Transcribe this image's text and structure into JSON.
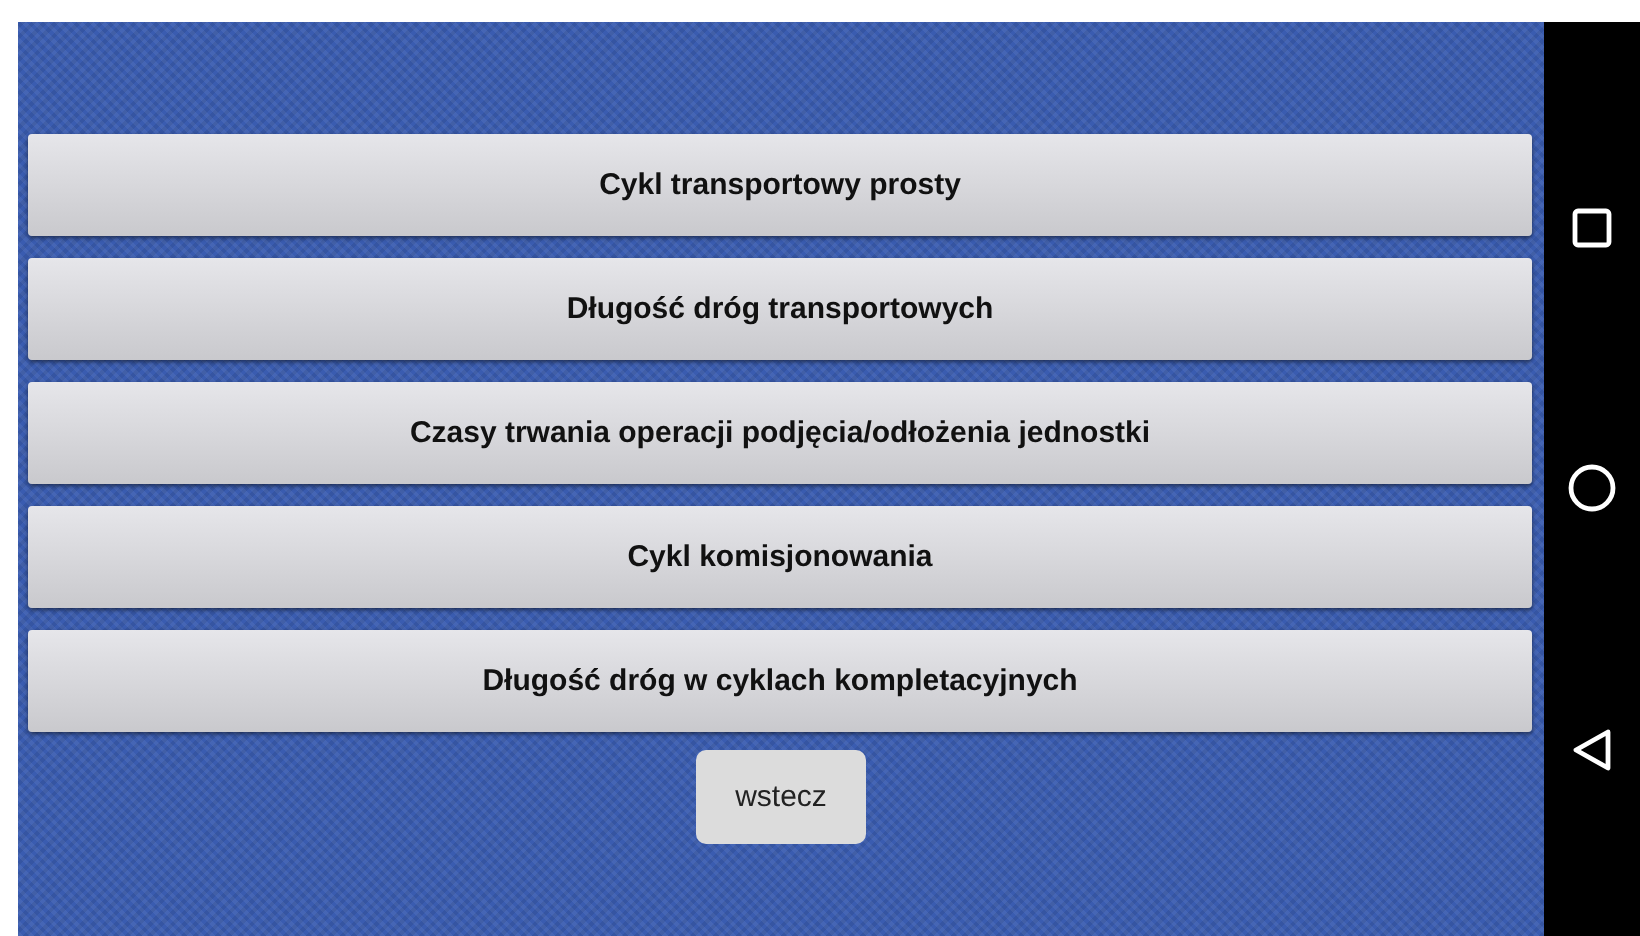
{
  "menu_buttons": [
    {
      "label": "Cykl transportowy prosty"
    },
    {
      "label": "Długość dróg transportowych"
    },
    {
      "label": "Czasy trwania operacji podjęcia/odłożenia jednostki"
    },
    {
      "label": "Cykl komisjonowania"
    },
    {
      "label": "Długość dróg w cyklach kompletacyjnych"
    }
  ],
  "back_button": {
    "label": "wstecz"
  }
}
